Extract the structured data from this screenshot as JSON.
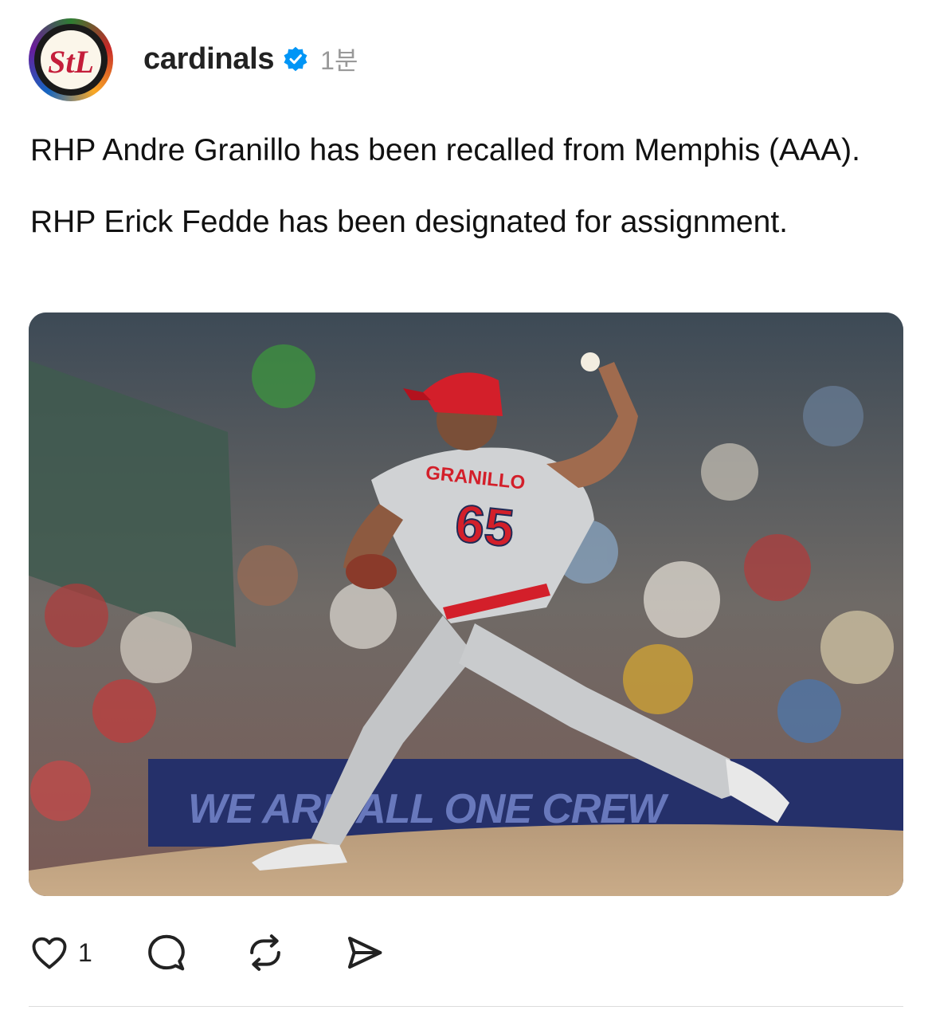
{
  "post": {
    "username": "cardinals",
    "time": "1분",
    "paragraphs": [
      "RHP Andre Granillo has been recalled from Memphis (AAA).",
      "RHP Erick Fedde has been designated for assignment."
    ],
    "verified_color": "#0095f6",
    "avatar_mark": "StL",
    "image": {
      "jersey_name": "GRANILLO",
      "jersey_number": "65",
      "banner_text": "WE ARE ALL ONE CREW",
      "jersey_color": "#c9cbcd",
      "accent_color": "#d31f2a"
    },
    "actions": {
      "like_count": "1",
      "icons": [
        "heart-icon",
        "comment-icon",
        "repost-icon",
        "share-icon"
      ]
    }
  }
}
